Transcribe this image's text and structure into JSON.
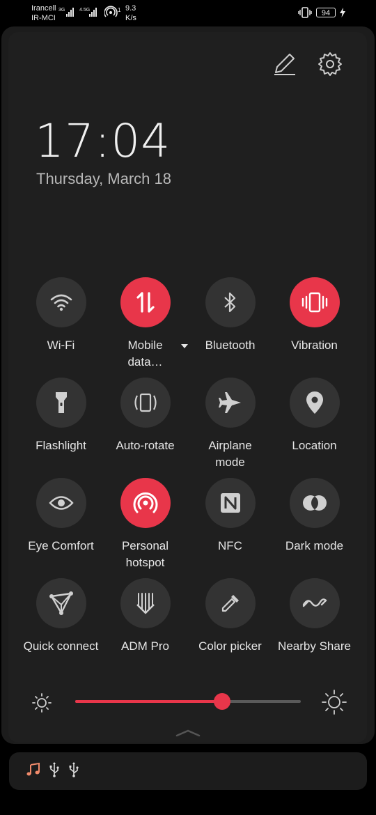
{
  "status_bar": {
    "carrier_1": "Irancell",
    "carrier_2": "IR-MCI",
    "net_1": "3G",
    "net_2": "4.5G",
    "hotspot_count": "1",
    "speed_value": "9.3",
    "speed_unit": "K/s",
    "battery_level": "94",
    "icons": [
      "signal-icon",
      "signal-icon",
      "hotspot-icon",
      "vibrate-icon",
      "battery-icon",
      "charging-icon"
    ]
  },
  "header": {
    "edit_icon": "pencil-icon",
    "settings_icon": "gear-icon"
  },
  "clock": {
    "time": "17:04",
    "date": "Thursday, March 18"
  },
  "quick_settings": [
    {
      "label": "Wi-Fi",
      "icon": "wifi-icon",
      "active": false
    },
    {
      "label": "Mobile data…",
      "icon": "mobile-data-icon",
      "active": true
    },
    {
      "label": "Bluetooth",
      "icon": "bluetooth-icon",
      "active": false
    },
    {
      "label": "Vibration",
      "icon": "vibration-icon",
      "active": true
    },
    {
      "label": "Flashlight",
      "icon": "flashlight-icon",
      "active": false
    },
    {
      "label": "Auto-rotate",
      "icon": "auto-rotate-icon",
      "active": false
    },
    {
      "label": "Airplane mode",
      "icon": "airplane-icon",
      "active": false
    },
    {
      "label": "Location",
      "icon": "location-icon",
      "active": false
    },
    {
      "label": "Eye Comfort",
      "icon": "eye-icon",
      "active": false
    },
    {
      "label": "Personal hotspot",
      "icon": "hotspot-icon",
      "active": true
    },
    {
      "label": "NFC",
      "icon": "nfc-icon",
      "active": false
    },
    {
      "label": "Dark mode",
      "icon": "dark-mode-icon",
      "active": false
    },
    {
      "label": "Quick connect",
      "icon": "quick-connect-icon",
      "active": false
    },
    {
      "label": "ADM Pro",
      "icon": "adm-pro-icon",
      "active": false
    },
    {
      "label": "Color picker",
      "icon": "color-picker-icon",
      "active": false
    },
    {
      "label": "Nearby Share",
      "icon": "nearby-share-icon",
      "active": false
    }
  ],
  "brightness": {
    "level": 0.65,
    "low_icon": "brightness-low-icon",
    "high_icon": "brightness-high-icon"
  },
  "colors": {
    "accent": "#e8364a",
    "tile_inactive": "#333333",
    "panel": "#1f1f1f"
  },
  "notifications": {
    "icons": [
      "music-note-icon",
      "usb-icon",
      "usb-icon"
    ]
  }
}
